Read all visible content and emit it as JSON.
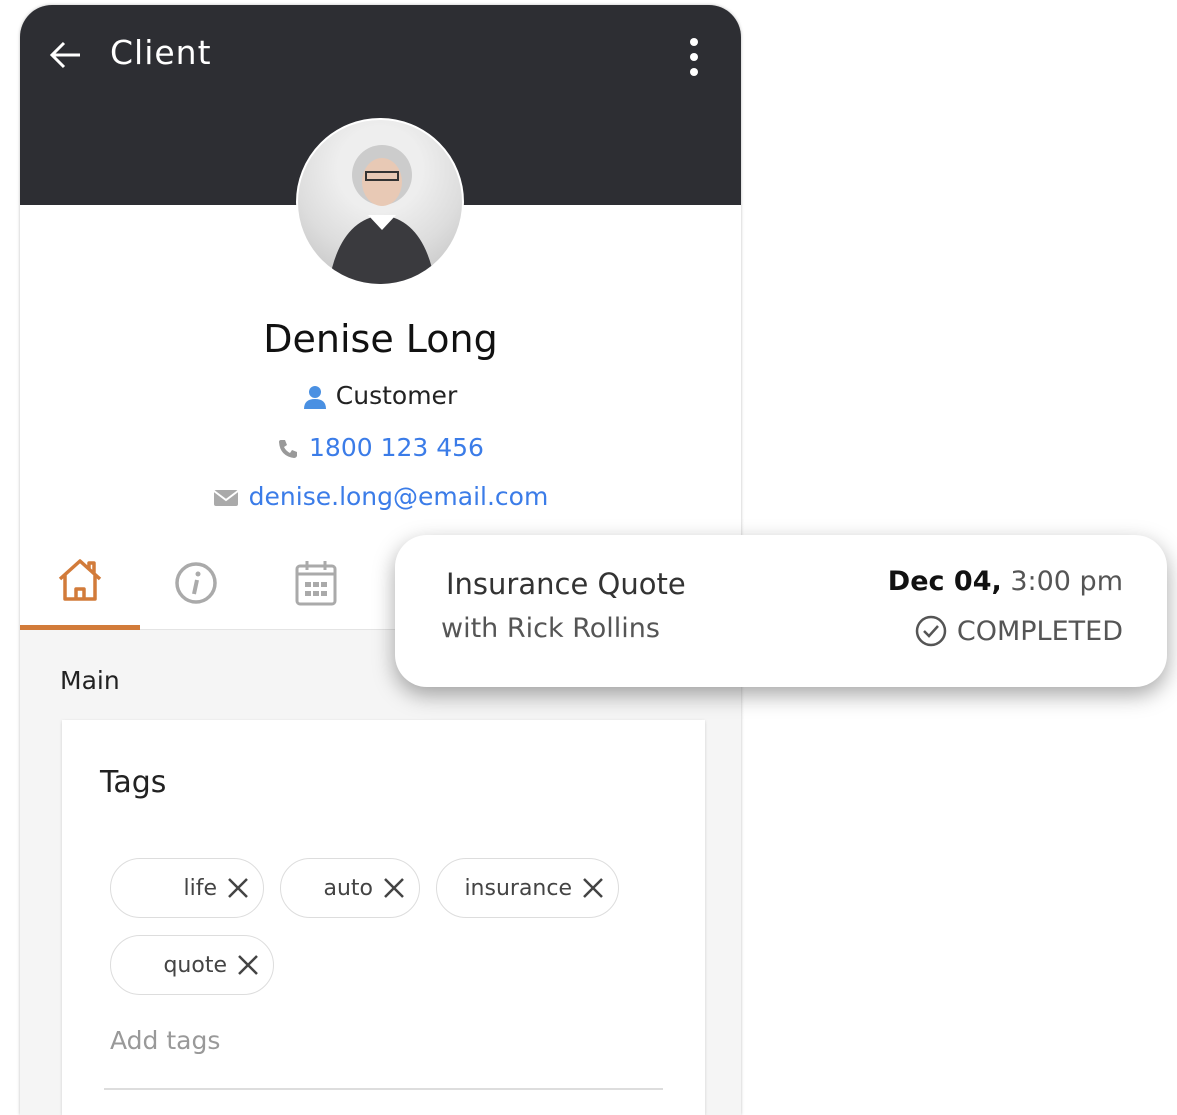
{
  "header": {
    "title": "Client"
  },
  "profile": {
    "name": "Denise Long",
    "role": "Customer",
    "phone": "1800 123 456",
    "email": "denise.long@email.com"
  },
  "tabs": [
    {
      "icon": "home-icon",
      "active": true
    },
    {
      "icon": "info-icon"
    },
    {
      "icon": "calendar-icon"
    }
  ],
  "main": {
    "section_label": "Main",
    "tags_title": "Tags",
    "tags": [
      "life",
      "auto",
      "insurance",
      "quote"
    ],
    "add_placeholder": "Add tags"
  },
  "appointment": {
    "title": "Insurance Quote",
    "with": "with Rick Rollins",
    "date": "Dec 04,",
    "time": "3:00 pm",
    "status": "COMPLETED"
  },
  "colors": {
    "accent": "#d27b3a",
    "link": "#3b7ce8",
    "header": "#2d2e33"
  }
}
